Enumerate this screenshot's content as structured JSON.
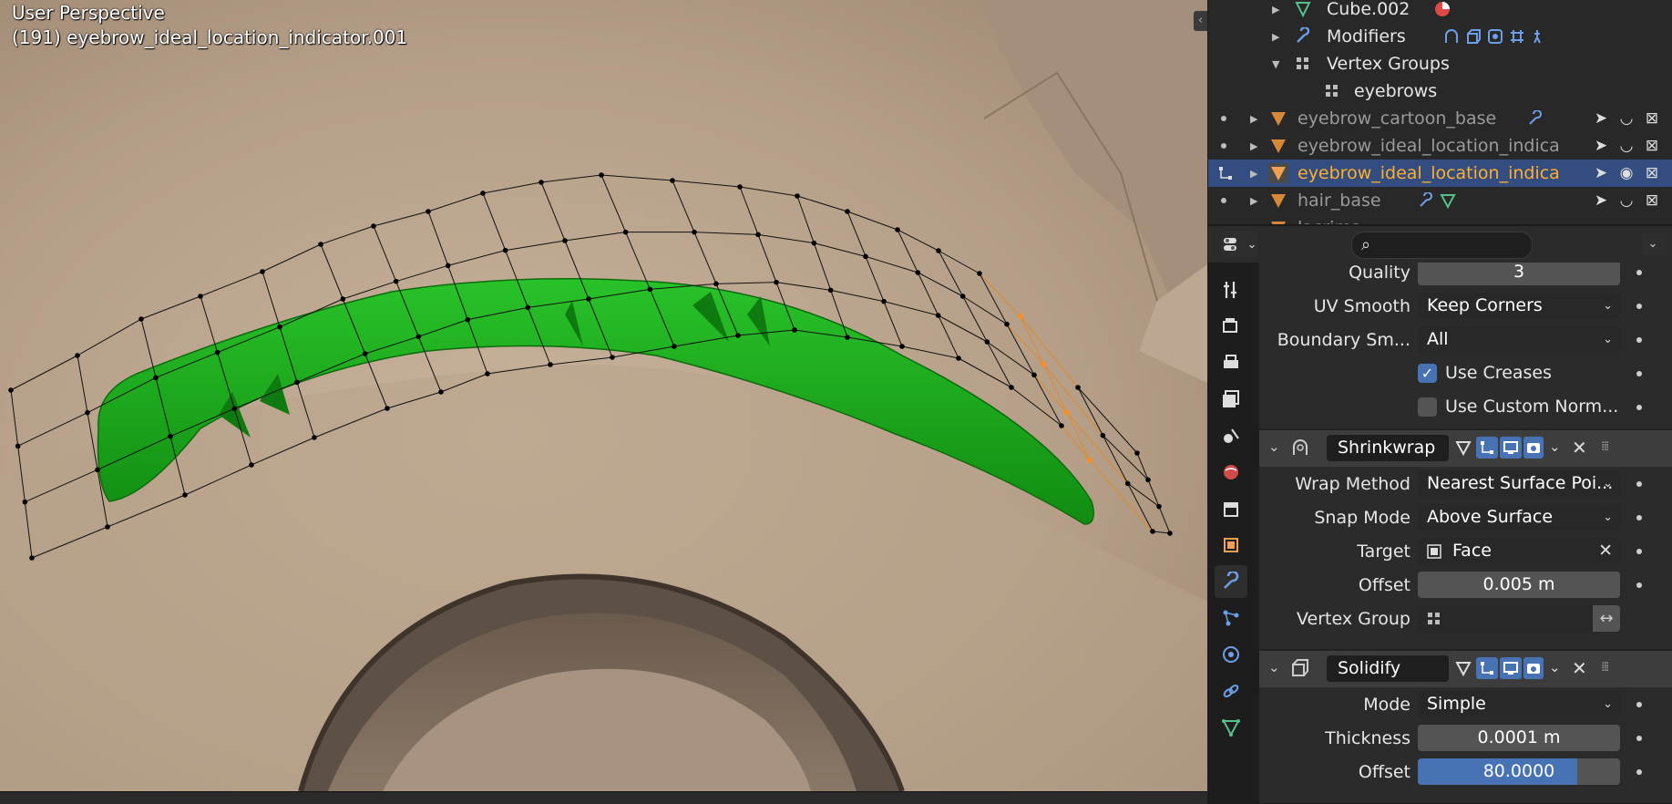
{
  "viewport": {
    "mode_label": "User Perspective",
    "object_label": "(191) eyebrow_ideal_location_indicator.001",
    "collapse_glyph": "‹"
  },
  "outliner": {
    "cube_label": "Cube.002",
    "modifiers_label": "Modifiers",
    "vertex_groups_label": "Vertex Groups",
    "vg_item_label": "eyebrows",
    "items": [
      {
        "label": "eyebrow_cartoon_base"
      },
      {
        "label": "eyebrow_ideal_location_indica"
      },
      {
        "label": "eyebrow_ideal_location_indica"
      },
      {
        "label": "hair_base"
      },
      {
        "label": "lacrima"
      }
    ]
  },
  "properties": {
    "search_placeholder": "",
    "subsurf": {
      "quality_label": "Quality",
      "quality_value": "3",
      "uv_smooth_label": "UV Smooth",
      "uv_smooth_value": "Keep Corners",
      "boundary_label": "Boundary Sm...",
      "boundary_value": "All",
      "use_creases_label": "Use Creases",
      "use_creases_checked": true,
      "use_custom_norm_label": "Use Custom Norm...",
      "use_custom_norm_checked": false
    },
    "shrinkwrap": {
      "name": "Shrinkwrap",
      "wrap_method_label": "Wrap Method",
      "wrap_method_value": "Nearest Surface Poi...",
      "snap_mode_label": "Snap Mode",
      "snap_mode_value": "Above Surface",
      "target_label": "Target",
      "target_value": "Face",
      "offset_label": "Offset",
      "offset_value": "0.005 m",
      "vertex_group_label": "Vertex Group",
      "vertex_group_value": ""
    },
    "solidify": {
      "name": "Solidify",
      "mode_label": "Mode",
      "mode_value": "Simple",
      "thickness_label": "Thickness",
      "thickness_value": "0.0001 m",
      "offset_label": "Offset",
      "offset_value": "80.0000",
      "offset_fraction": 0.79
    }
  },
  "colors": {
    "active_object": "#ffaf29",
    "selected_row": "#334d80",
    "accent_blue": "#4772b3",
    "eyebrow_green": "#1fa31f"
  }
}
